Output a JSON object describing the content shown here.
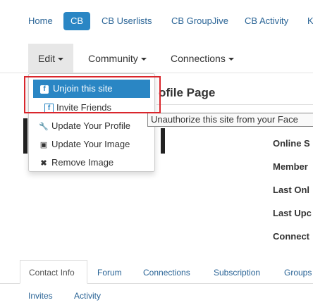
{
  "topnav": {
    "home": "Home",
    "cb_badge": "CB",
    "userlists": "CB Userlists",
    "groupjive": "CB GroupJive",
    "activity": "CB Activity",
    "overflow": "K"
  },
  "subnav": {
    "edit": "Edit",
    "community": "Community",
    "connections": "Connections"
  },
  "dropdown": {
    "unjoin": "Unjoin this site",
    "invite": "Invite Friends",
    "update_profile": "Update Your Profile",
    "update_image": "Update Your Image",
    "remove_image": "Remove Image"
  },
  "page": {
    "title_fragment": "ofile Page",
    "tooltip": "Unauthorize this site from your Face"
  },
  "info": {
    "online": "Online S",
    "member": "Member",
    "last_online": "Last Onl",
    "last_update": "Last Upc",
    "connections": "Connect"
  },
  "tabs": {
    "contact": "Contact Info",
    "forum": "Forum",
    "connections": "Connections",
    "subscription": "Subscription",
    "groups": "Groups",
    "invites": "Invites",
    "activity": "Activity"
  },
  "colors": {
    "accent": "#2a86c4",
    "link": "#2a6496",
    "highlight_box": "#d9262c"
  }
}
